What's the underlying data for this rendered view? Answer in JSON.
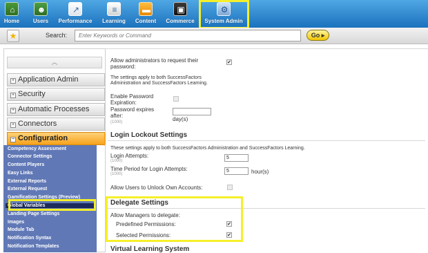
{
  "nav": {
    "items": [
      {
        "label": "Home",
        "icon": "home-icon"
      },
      {
        "label": "Users",
        "icon": "users-icon"
      },
      {
        "label": "Performance",
        "icon": "performance-icon"
      },
      {
        "label": "Learning",
        "icon": "learning-icon"
      },
      {
        "label": "Content",
        "icon": "content-icon"
      },
      {
        "label": "Commerce",
        "icon": "commerce-icon"
      },
      {
        "label": "System Admin",
        "icon": "system-admin-icon"
      }
    ],
    "highlighted": "System Admin"
  },
  "search": {
    "label": "Search:",
    "placeholder": "Enter Keywords or Command",
    "go_label": "Go"
  },
  "sidebar": {
    "sections": [
      {
        "label": "Application Admin",
        "marker": "+"
      },
      {
        "label": "Security",
        "marker": "+"
      },
      {
        "label": "Automatic Processes",
        "marker": "+"
      },
      {
        "label": "Connectors",
        "marker": "+"
      },
      {
        "label": "Configuration",
        "marker": "−",
        "active": true
      }
    ],
    "submenu": [
      "Competency Assessment",
      "Connector Settings",
      "Content Players",
      "Easy Links",
      "External Reports",
      "External Request",
      "Gamification Settings (Preview)",
      "Global Variables",
      "Landing Page Settings",
      "Images",
      "Module Tab",
      "Notification Syntax",
      "Notification Templates"
    ],
    "selected": "Global Variables"
  },
  "main": {
    "password": {
      "allow_request": "Allow administrators to request their password:",
      "allow_request_checked": true,
      "note": "The settings apply to both SuccessFactors Administration and SuccessFactors Learning.",
      "enable_expiration": "Enable Password Expiration:",
      "enable_expiration_checked": false,
      "expires_after": "Password expires after:",
      "expires_after_range": "(1000)",
      "expires_after_unit": "day(s)",
      "expires_after_value": ""
    },
    "lockout": {
      "heading": "Login Lockout Settings",
      "note": "These settings apply to both SuccessFactors Administration and SuccessFactors Learning.",
      "attempts_label": "Login Attempts:",
      "attempts_range": "(1000)",
      "attempts_value": "5",
      "period_label": "Time Period for Login Attempts:",
      "period_range": "(1000)",
      "period_value": "5",
      "period_unit": "hour(s)",
      "unlock_label": "Allow Users to Unlock Own Accounts:",
      "unlock_checked": false
    },
    "delegate": {
      "heading": "Delegate Settings",
      "allow_label": "Allow Managers to delegate:",
      "predefined_label": "Predefined Permissions:",
      "predefined_checked": true,
      "selected_label": "Selected Permissions:",
      "selected_checked": true
    },
    "virtual": {
      "heading": "Virtual Learning System"
    }
  },
  "colors": {
    "nav_top": "#4fa7e3",
    "nav_bottom": "#1b72be",
    "highlight": "#f5ef2a",
    "submenu_bg": "#6078b6",
    "active_section": "#f7a21b"
  }
}
